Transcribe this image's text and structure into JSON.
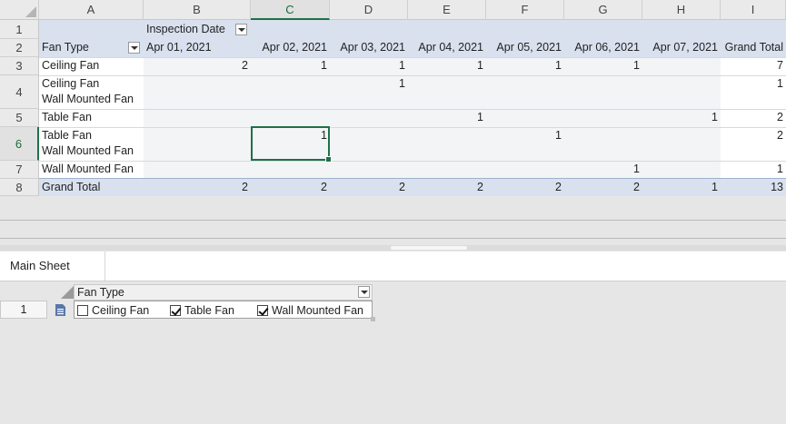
{
  "columns": [
    "A",
    "B",
    "C",
    "D",
    "E",
    "F",
    "G",
    "H",
    "I"
  ],
  "rows": [
    "1",
    "2",
    "3",
    "4",
    "5",
    "6",
    "7",
    "8"
  ],
  "pivot": {
    "column_field": "Inspection Date",
    "row_field": "Fan Type",
    "dates": [
      "Apr 01, 2021",
      "Apr 02, 2021",
      "Apr 03, 2021",
      "Apr 04, 2021",
      "Apr 05, 2021",
      "Apr 06, 2021",
      "Apr 07, 2021"
    ],
    "grand_total_label": "Grand Total",
    "data_rows": [
      {
        "label_lines": [
          "Ceiling Fan"
        ],
        "values": [
          "2",
          "1",
          "1",
          "1",
          "1",
          "1",
          ""
        ],
        "total": "7"
      },
      {
        "label_lines": [
          "Ceiling Fan",
          "Wall Mounted Fan"
        ],
        "values": [
          "",
          "",
          "1",
          "",
          "",
          "",
          ""
        ],
        "total": "1"
      },
      {
        "label_lines": [
          "Table Fan"
        ],
        "values": [
          "",
          "",
          "",
          "1",
          "",
          "",
          "1"
        ],
        "total": "2"
      },
      {
        "label_lines": [
          "Table Fan",
          "Wall Mounted Fan"
        ],
        "values": [
          "",
          "1",
          "",
          "",
          "1",
          "",
          ""
        ],
        "total": "2"
      },
      {
        "label_lines": [
          "Wall Mounted Fan"
        ],
        "values": [
          "",
          "",
          "",
          "",
          "",
          "1",
          ""
        ],
        "total": "1"
      }
    ],
    "grand_totals": [
      "2",
      "2",
      "2",
      "2",
      "2",
      "2",
      "1"
    ],
    "grand_total_all": "13"
  },
  "selection": {
    "column": "C",
    "row": "6"
  },
  "sheet_tab": {
    "label": "Main Sheet"
  },
  "slicer": {
    "row_number": "1",
    "header": "Fan Type",
    "options": [
      {
        "label": "Ceiling Fan",
        "checked": false
      },
      {
        "label": "Table Fan",
        "checked": true
      },
      {
        "label": "Wall Mounted Fan",
        "checked": true
      }
    ]
  },
  "colors": {
    "accent": "#1e7145",
    "pivot_header": "#d9e1ef",
    "pivot_body": "#f3f4f6"
  }
}
